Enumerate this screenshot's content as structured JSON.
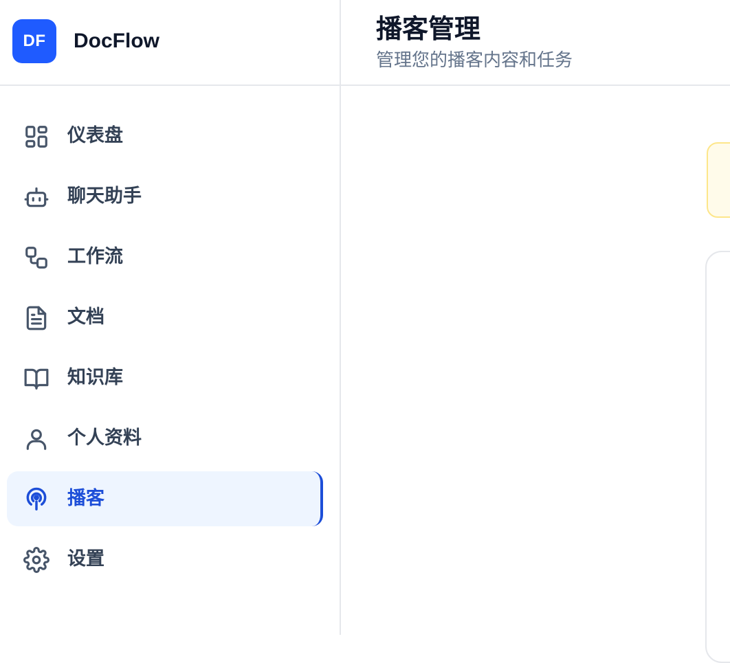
{
  "brand": {
    "logo_text": "DF",
    "name": "DocFlow",
    "color": "#1f5bff"
  },
  "sidebar": {
    "items": [
      {
        "label": "仪表盘",
        "icon": "dashboard-grid-icon",
        "active": false
      },
      {
        "label": "聊天助手",
        "icon": "bot-icon",
        "active": false
      },
      {
        "label": "工作流",
        "icon": "workflow-icon",
        "active": false
      },
      {
        "label": "文档",
        "icon": "document-icon",
        "active": false
      },
      {
        "label": "知识库",
        "icon": "book-open-icon",
        "active": false
      },
      {
        "label": "个人资料",
        "icon": "user-icon",
        "active": false
      },
      {
        "label": "播客",
        "icon": "podcast-icon",
        "active": true
      },
      {
        "label": "设置",
        "icon": "gear-icon",
        "active": false
      }
    ],
    "active_color": "#1d4ed8"
  },
  "header": {
    "title": "播客管理",
    "subtitle": "管理您的播客内容和任务"
  }
}
